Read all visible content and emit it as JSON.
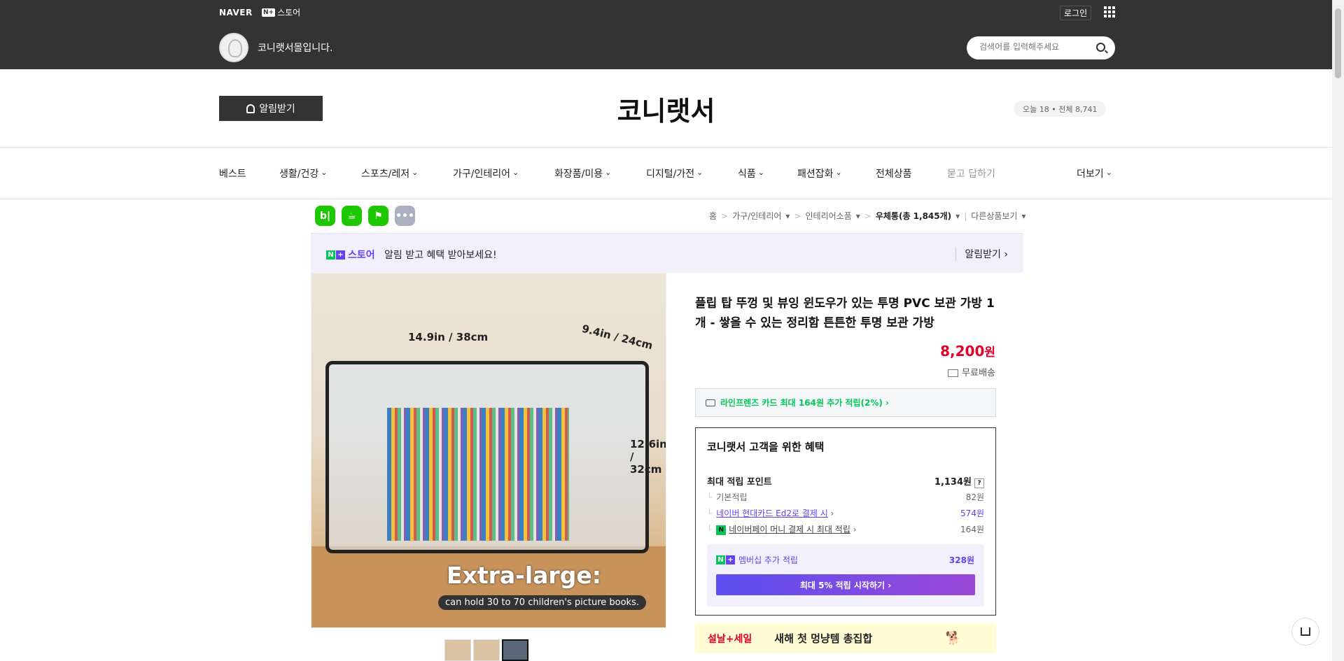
{
  "topbar": {
    "naver": "NAVER",
    "nplus_badge": "N+",
    "store": "스토어",
    "login": "로그인",
    "shop_intro": "코니랫서몰입니다.",
    "search_placeholder": "검색어를 입력해주세요"
  },
  "header": {
    "alarm_button": "알림받기",
    "brand": "코니랫서",
    "visits": "오늘 18 • 전체 8,741"
  },
  "nav": {
    "items": [
      "베스트",
      "생활/건강",
      "스포츠/레저",
      "가구/인테리어",
      "화장품/미용",
      "디지털/가전",
      "식품",
      "패션잡화",
      "전체상품",
      "묻고 답하기",
      "더보기"
    ]
  },
  "socials": [
    {
      "name": "blog-icon",
      "glyph": "b|"
    },
    {
      "name": "cafe-icon",
      "glyph": "☕"
    },
    {
      "name": "bookmark-icon",
      "glyph": "⚑"
    },
    {
      "name": "more-icon",
      "glyph": "•••"
    }
  ],
  "breadcrumb": {
    "home": "홈",
    "cat1": "가구/인테리어",
    "cat2": "인테리어소품",
    "cat3": "우체통(총 1,845개)",
    "other": "다른상품보기"
  },
  "promo": {
    "store": "스토어",
    "text": "알림 받고 혜택 받아보세요!",
    "alarm": "알림받기 ›"
  },
  "image": {
    "dim_width": "14.9in / 38cm",
    "dim_depth": "9.4in / 24cm",
    "dim_height_1": "12.6in",
    "dim_height_2": "/ 32cm",
    "headline": "Extra-large:",
    "caption": "can hold 30 to 70 children's picture books."
  },
  "product": {
    "title": "플립 탑 뚜껑 및 뷰잉 윈도우가 있는 투명 PVC 보관 가방 1개 - 쌓을 수 있는 정리함 튼튼한 투명 보관 가방",
    "price": "8,200",
    "currency": "원",
    "shipping": "무료배송",
    "card_benefit": "라인프렌즈 카드 최대 164원 추가 적립(2%) ›"
  },
  "benefit": {
    "title": "코니랫서 고객을 위한 혜택",
    "max_points_label": "최대 적립 포인트",
    "max_points_value": "1,134원",
    "basic_label": "기본적립",
    "basic_value": "82원",
    "card_label": "네이버 현대카드 Ed2로 결제 시",
    "card_value": "574원",
    "npay_label": "네이버페이 머니 결제 시 최대 적립",
    "npay_value": "164원",
    "member_label": "멤버십 추가 적립",
    "member_value": "328원",
    "member_button": "최대 5% 적립 시작하기 ›"
  },
  "banner": {
    "sale": "설날+세일",
    "text": "새해 첫 멍냥템 총집합",
    "emoji": "🐕"
  }
}
